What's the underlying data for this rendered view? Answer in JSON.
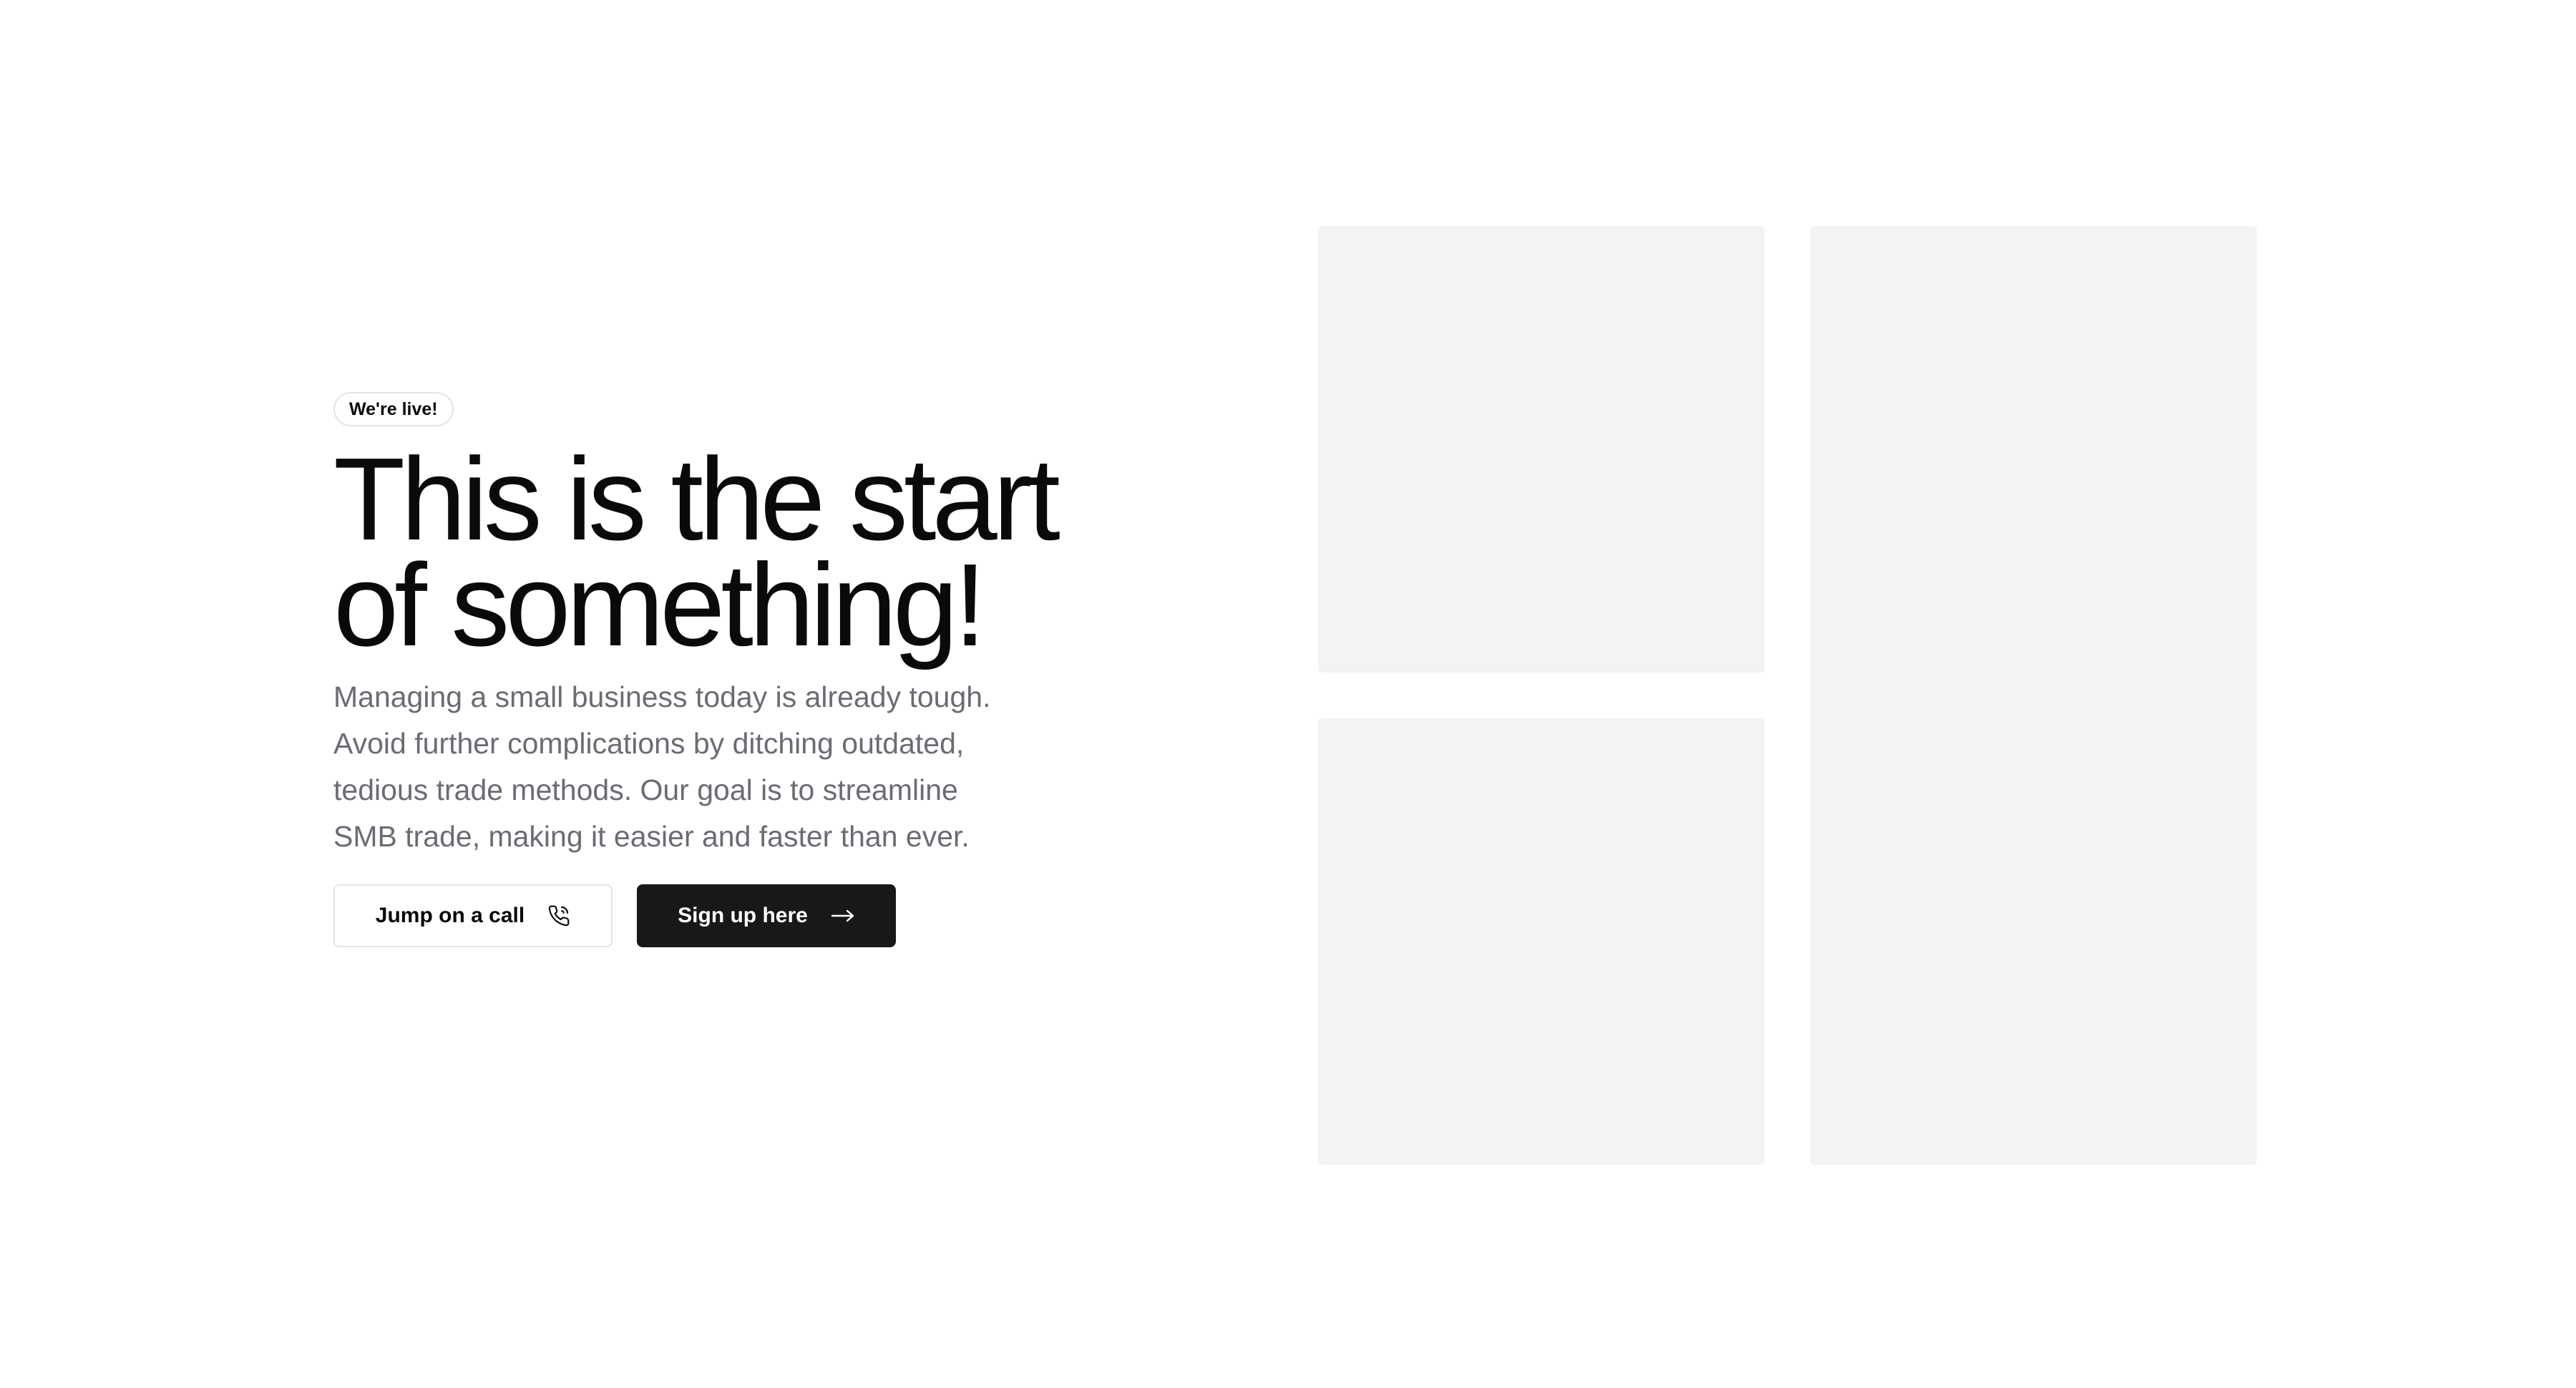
{
  "hero": {
    "badge": "We're live!",
    "title_line1": "This is the start",
    "title_line2": "of something!",
    "description": "Managing a small business today is already tough. Avoid further complications by ditching outdated, tedious trade methods. Our goal is to streamline SMB trade, making it easier and faster than ever.",
    "secondary_button": {
      "label": "Jump on a call",
      "icon": "phone-icon"
    },
    "primary_button": {
      "label": "Sign up here",
      "icon": "arrow-right-icon"
    }
  },
  "gallery": {
    "tile_color": "#f3f3f3",
    "tiles": [
      "image-placeholder",
      "image-placeholder",
      "image-placeholder"
    ]
  },
  "colors": {
    "text": "#0a0a0a",
    "muted": "#6b6b73",
    "primary_bg": "#18181a",
    "border": "#e4e4e7"
  }
}
